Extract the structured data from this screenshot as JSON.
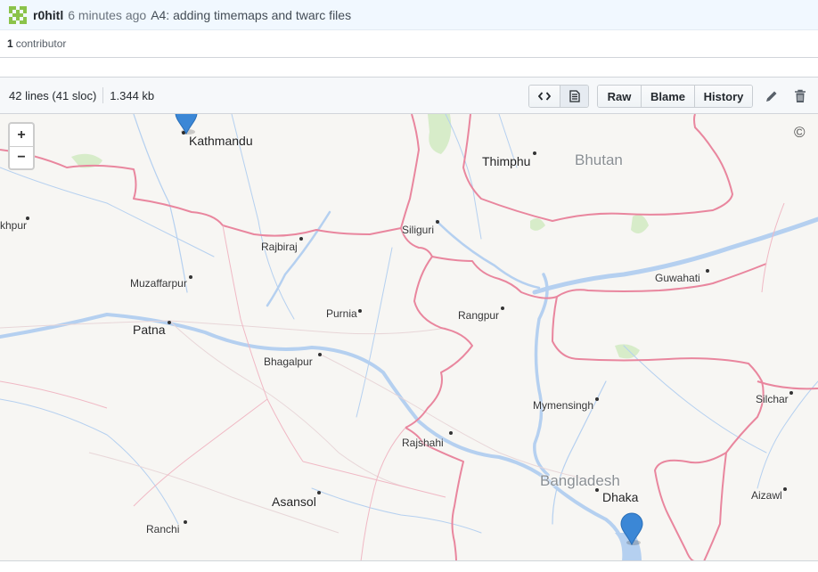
{
  "commit": {
    "author": "r0hitl",
    "time": "6 minutes ago",
    "message": "A4: adding timemaps and twarc files"
  },
  "contributors": {
    "count": "1",
    "label": "contributor"
  },
  "file": {
    "lines": "42 lines (41 sloc)",
    "size": "1.344 kb",
    "raw_label": "Raw",
    "blame_label": "Blame",
    "history_label": "History"
  },
  "map": {
    "zoom_in": "+",
    "zoom_out": "−",
    "attribution_symbol": "©",
    "country_labels": {
      "bhutan": "Bhutan",
      "bangladesh": "Bangladesh"
    },
    "city_labels": {
      "kathmandu": "Kathmandu",
      "thimphu": "Thimphu",
      "siliguri": "Siliguri",
      "rajbiraj": "Rajbiraj",
      "muzaffarpur": "Muzaffarpur",
      "guwahati": "Guwahati",
      "purnia": "Purnia",
      "rangpur": "Rangpur",
      "patna": "Patna",
      "bhagalpur": "Bhagalpur",
      "mymensingh": "Mymensingh",
      "silchar": "Silchar",
      "rajshahi": "Rajshahi",
      "dhaka": "Dhaka",
      "asansol": "Asansol",
      "aizawl": "Aizawl",
      "ranchi": "Ranchi",
      "gorakhpur_partial": "khpur"
    },
    "marker_color": "#3b87d6",
    "border_color": "#e9869e",
    "water_color": "#b5d0f0"
  },
  "colors": {
    "accent": "#0366d6",
    "commit_bg": "#f1f8ff"
  }
}
